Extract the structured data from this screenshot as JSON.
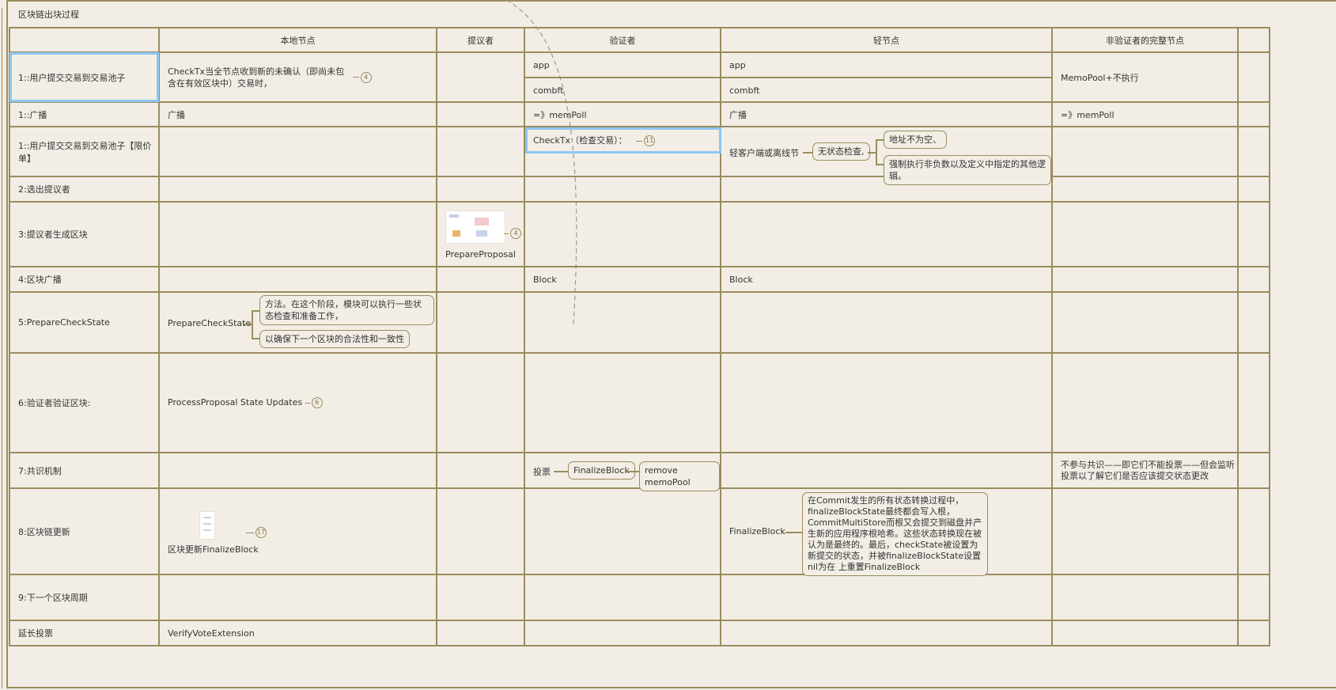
{
  "title": "区块链出块过程",
  "headers": [
    "本地节点",
    "提议者",
    "验证者",
    "轻节点",
    "非验证者的完整节点"
  ],
  "rows": {
    "r1": {
      "label": "1::用户提交交易到交易池子",
      "local": "CheckTx当全节点收到新的未确认（即尚未包含在有效区块中）交易时，",
      "local_badge": "4",
      "verifier_app": "app",
      "verifier_combft": "combft",
      "light_app": "app",
      "light_combft": "combft",
      "full": "MemoPool+不执行"
    },
    "r2": {
      "label": "1::广播",
      "local": "广播",
      "verifier": "=》memPoll",
      "light": "广播",
      "full": "=》memPoll"
    },
    "r3": {
      "label": "1::用户提交交易到交易池子【限价单】",
      "verifier": "CheckTx（检查交易）：",
      "verifier_badge": "11",
      "light_root": "轻客户端或离线节",
      "light_mid": "无状态检查,",
      "light_a": "地址不为空、",
      "light_b": "强制执行非负数以及定义中指定的其他逻辑。"
    },
    "r4": {
      "label": "2:选出提议者"
    },
    "r5": {
      "label": "3:提议者生成区块",
      "proposer": "PrepareProposal",
      "proposer_badge": "4"
    },
    "r6": {
      "label": "4:区块广播",
      "verifier": "Block",
      "light": "Block"
    },
    "r7": {
      "label": "5:PrepareCheckState",
      "local_root": "PrepareCheckState",
      "local_a": "方法。在这个阶段，模块可以执行一些状态检查和准备工作，",
      "local_b": "以确保下一个区块的合法性和一致性"
    },
    "r8": {
      "label": "6:验证者验证区块:",
      "local": "ProcessProposal State Updates",
      "local_badge": "6"
    },
    "r9": {
      "label": "7:共识机制",
      "verifier_root": "投票",
      "verifier_a": "FinalizeBlock",
      "verifier_b": "remove memoPool",
      "full": "不参与共识——即它们不能投票——但会监听投票以了解它们是否应该提交状态更改"
    },
    "r10": {
      "label": "8:区块链更新",
      "local": "区块更新FinalizeBlock",
      "local_badge": "17",
      "light_root": "FinalizeBlock",
      "light_note": "在Commit发生的所有状态转换过程中，finalizeBlockState最终都会写入根，CommitMultiStore而根又会提交到磁盘并产生新的应用程序根哈希。这些状态转换现在被认为是最终的。最后，checkState被设置为新提交的状态，并被finalizeBlockState设置nil为在 上重置FinalizeBlock"
    },
    "r11": {
      "label": "9:下一个区块周期"
    },
    "r12": {
      "label": "延长投票",
      "local": "VerifyVoteExtension"
    }
  }
}
